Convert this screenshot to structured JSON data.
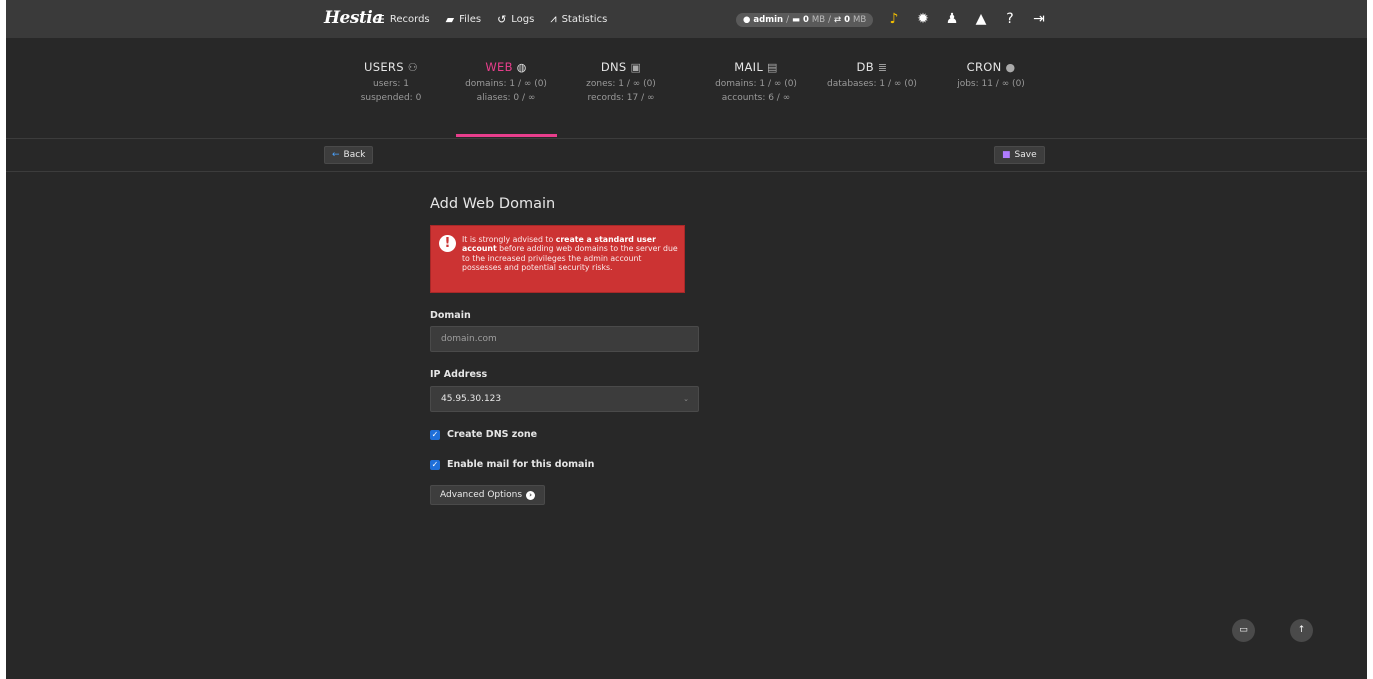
{
  "brand": {
    "logo_text": "Hestia"
  },
  "nav": [
    {
      "icon": "list-icon",
      "glyph": "☰",
      "label": "Records"
    },
    {
      "icon": "folder-icon",
      "glyph": "▰",
      "label": "Files"
    },
    {
      "icon": "history-icon",
      "glyph": "↺",
      "label": "Logs"
    },
    {
      "icon": "chart-icon",
      "glyph": "⩘",
      "label": "Statistics"
    }
  ],
  "user_pill": {
    "user": "admin",
    "disk_used": "0",
    "disk_unit": "MB",
    "bw_used": "0",
    "bw_unit": "MB"
  },
  "top_icons": [
    "bell-icon",
    "gear-icon",
    "user-edit-icon",
    "warning-icon",
    "help-icon",
    "logout-icon"
  ],
  "stats": {
    "users": {
      "title": "USERS",
      "row1": "users:   1",
      "row2": "suspended:   0"
    },
    "web": {
      "title": "WEB",
      "row1": "domains:   1 / ∞ (0)",
      "row2": "aliases:   0 / ∞"
    },
    "dns": {
      "title": "DNS",
      "row1": "zones:   1 / ∞ (0)",
      "row2": "records:   17 / ∞"
    },
    "mail": {
      "title": "MAIL",
      "row1": "domains:   1 / ∞ (0)",
      "row2": "accounts:   6 / ∞"
    },
    "db": {
      "title": "DB",
      "row1": "databases:   1 / ∞ (0)",
      "row2": ""
    },
    "cron": {
      "title": "CRON",
      "row1": "jobs:   11 / ∞ (0)",
      "row2": ""
    }
  },
  "toolbar": {
    "back_label": "Back",
    "save_label": "Save"
  },
  "form": {
    "title": "Add Web Domain",
    "alert": {
      "pre": "It is strongly advised to ",
      "bold": "create a standard user account",
      "post": " before adding web domains to the server due to the increased privileges the admin account possesses and potential security risks."
    },
    "domain_label": "Domain",
    "domain_placeholder": "domain.com",
    "ip_label": "IP Address",
    "ip_value": "45.95.30.123",
    "dns_label": "Create DNS zone",
    "dns_checked": true,
    "mail_label": "Enable mail for this domain",
    "mail_checked": true,
    "advanced_label": "Advanced Options"
  },
  "colors": {
    "accent": "#e83e8c",
    "alert": "#cc3333",
    "checkbox": "#1e6fd9"
  }
}
